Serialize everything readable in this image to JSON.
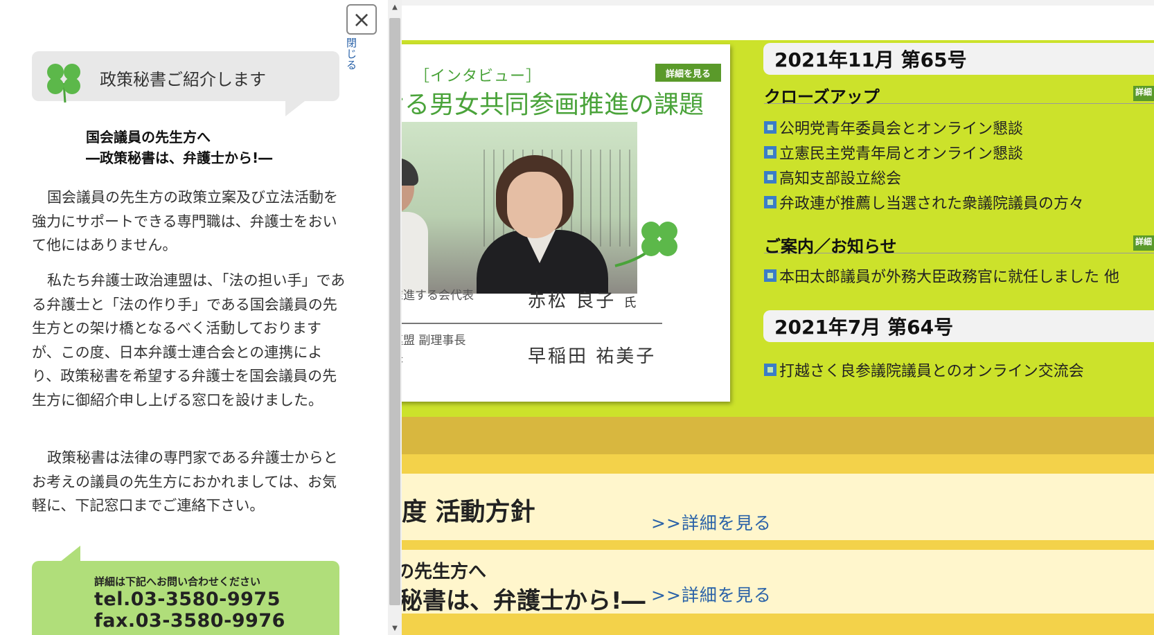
{
  "colors": {
    "accent_green": "#cce22b",
    "link_blue": "#2a62a8",
    "gold": "#d8b73f",
    "cream": "#fff6cc",
    "contact_green": "#b0de7a"
  },
  "panel": {
    "close_glyph": "×",
    "close_label": "閉じる",
    "bubble_text": "政策秘書ご紹介します",
    "heading_line1": "国会議員の先生方へ",
    "heading_line2": "―政策秘書は、弁護士から!―",
    "paragraphs": [
      "国会議員の先生方の政策立案及び立法活動を強力にサポートできる専門職は、弁護士をおいて他にはありません。",
      "私たち弁護士政治連盟は、「法の担い手」である弁護士と「法の作り手」である国会議員の先生方との架け橋となるべく活動しておりますが、この度、日本弁護士連合会との連携により、政策秘書を希望する弁護士を国会議員の先生方に御紹介申し上げる窓口を設けました。",
      "政策秘書は法律の専門家である弁護士からとお考えの議員の先生方におかれましては、お気軽に、下記窓口までご連絡下さい。"
    ],
    "contact_note": "詳細は下記へお問い合わせください",
    "contact_tel": "tel.03-3580-9975",
    "contact_fax": "fax.03-3580-9976"
  },
  "feature_card": {
    "kicker": "［インタビュー］",
    "detail_badge": "詳細を見る",
    "title": "ける男女共同参画推進の課題",
    "row1_role": "を推進する会代表",
    "row1_name": "赤松 良子",
    "row1_suffix": "氏",
    "row2_role": "治連盟 副理事長\n会長",
    "row2_name": "早稲田 祐美子"
  },
  "issues": [
    {
      "heading": "2021年11月 第65号",
      "sections": [
        {
          "title": "クローズアップ",
          "badge": "詳細",
          "items": [
            "公明党青年委員会とオンライン懇談",
            "立憲民主党青年局とオンライン懇談",
            "高知支部設立総会",
            "弁政連が推薦し当選された衆議院議員の方々"
          ]
        },
        {
          "title": "ご案内／お知らせ",
          "badge": "詳細",
          "items": [
            "本田太郎議員が外務大臣政務官に就任しました 他"
          ]
        }
      ]
    },
    {
      "heading": "2021年7月 第64号",
      "items": [
        "打越さく良参議院議員とのオンライン交流会"
      ]
    }
  ],
  "policy": {
    "title": "度 活動方針",
    "detail_link": ">>詳細を見る"
  },
  "intro": {
    "line1": "の先生方へ",
    "line2": "秘書は、弁護士から!―",
    "detail_link": ">>詳細を見る"
  },
  "scrollbar": {
    "up_glyph": "▲",
    "down_glyph": "▼"
  }
}
